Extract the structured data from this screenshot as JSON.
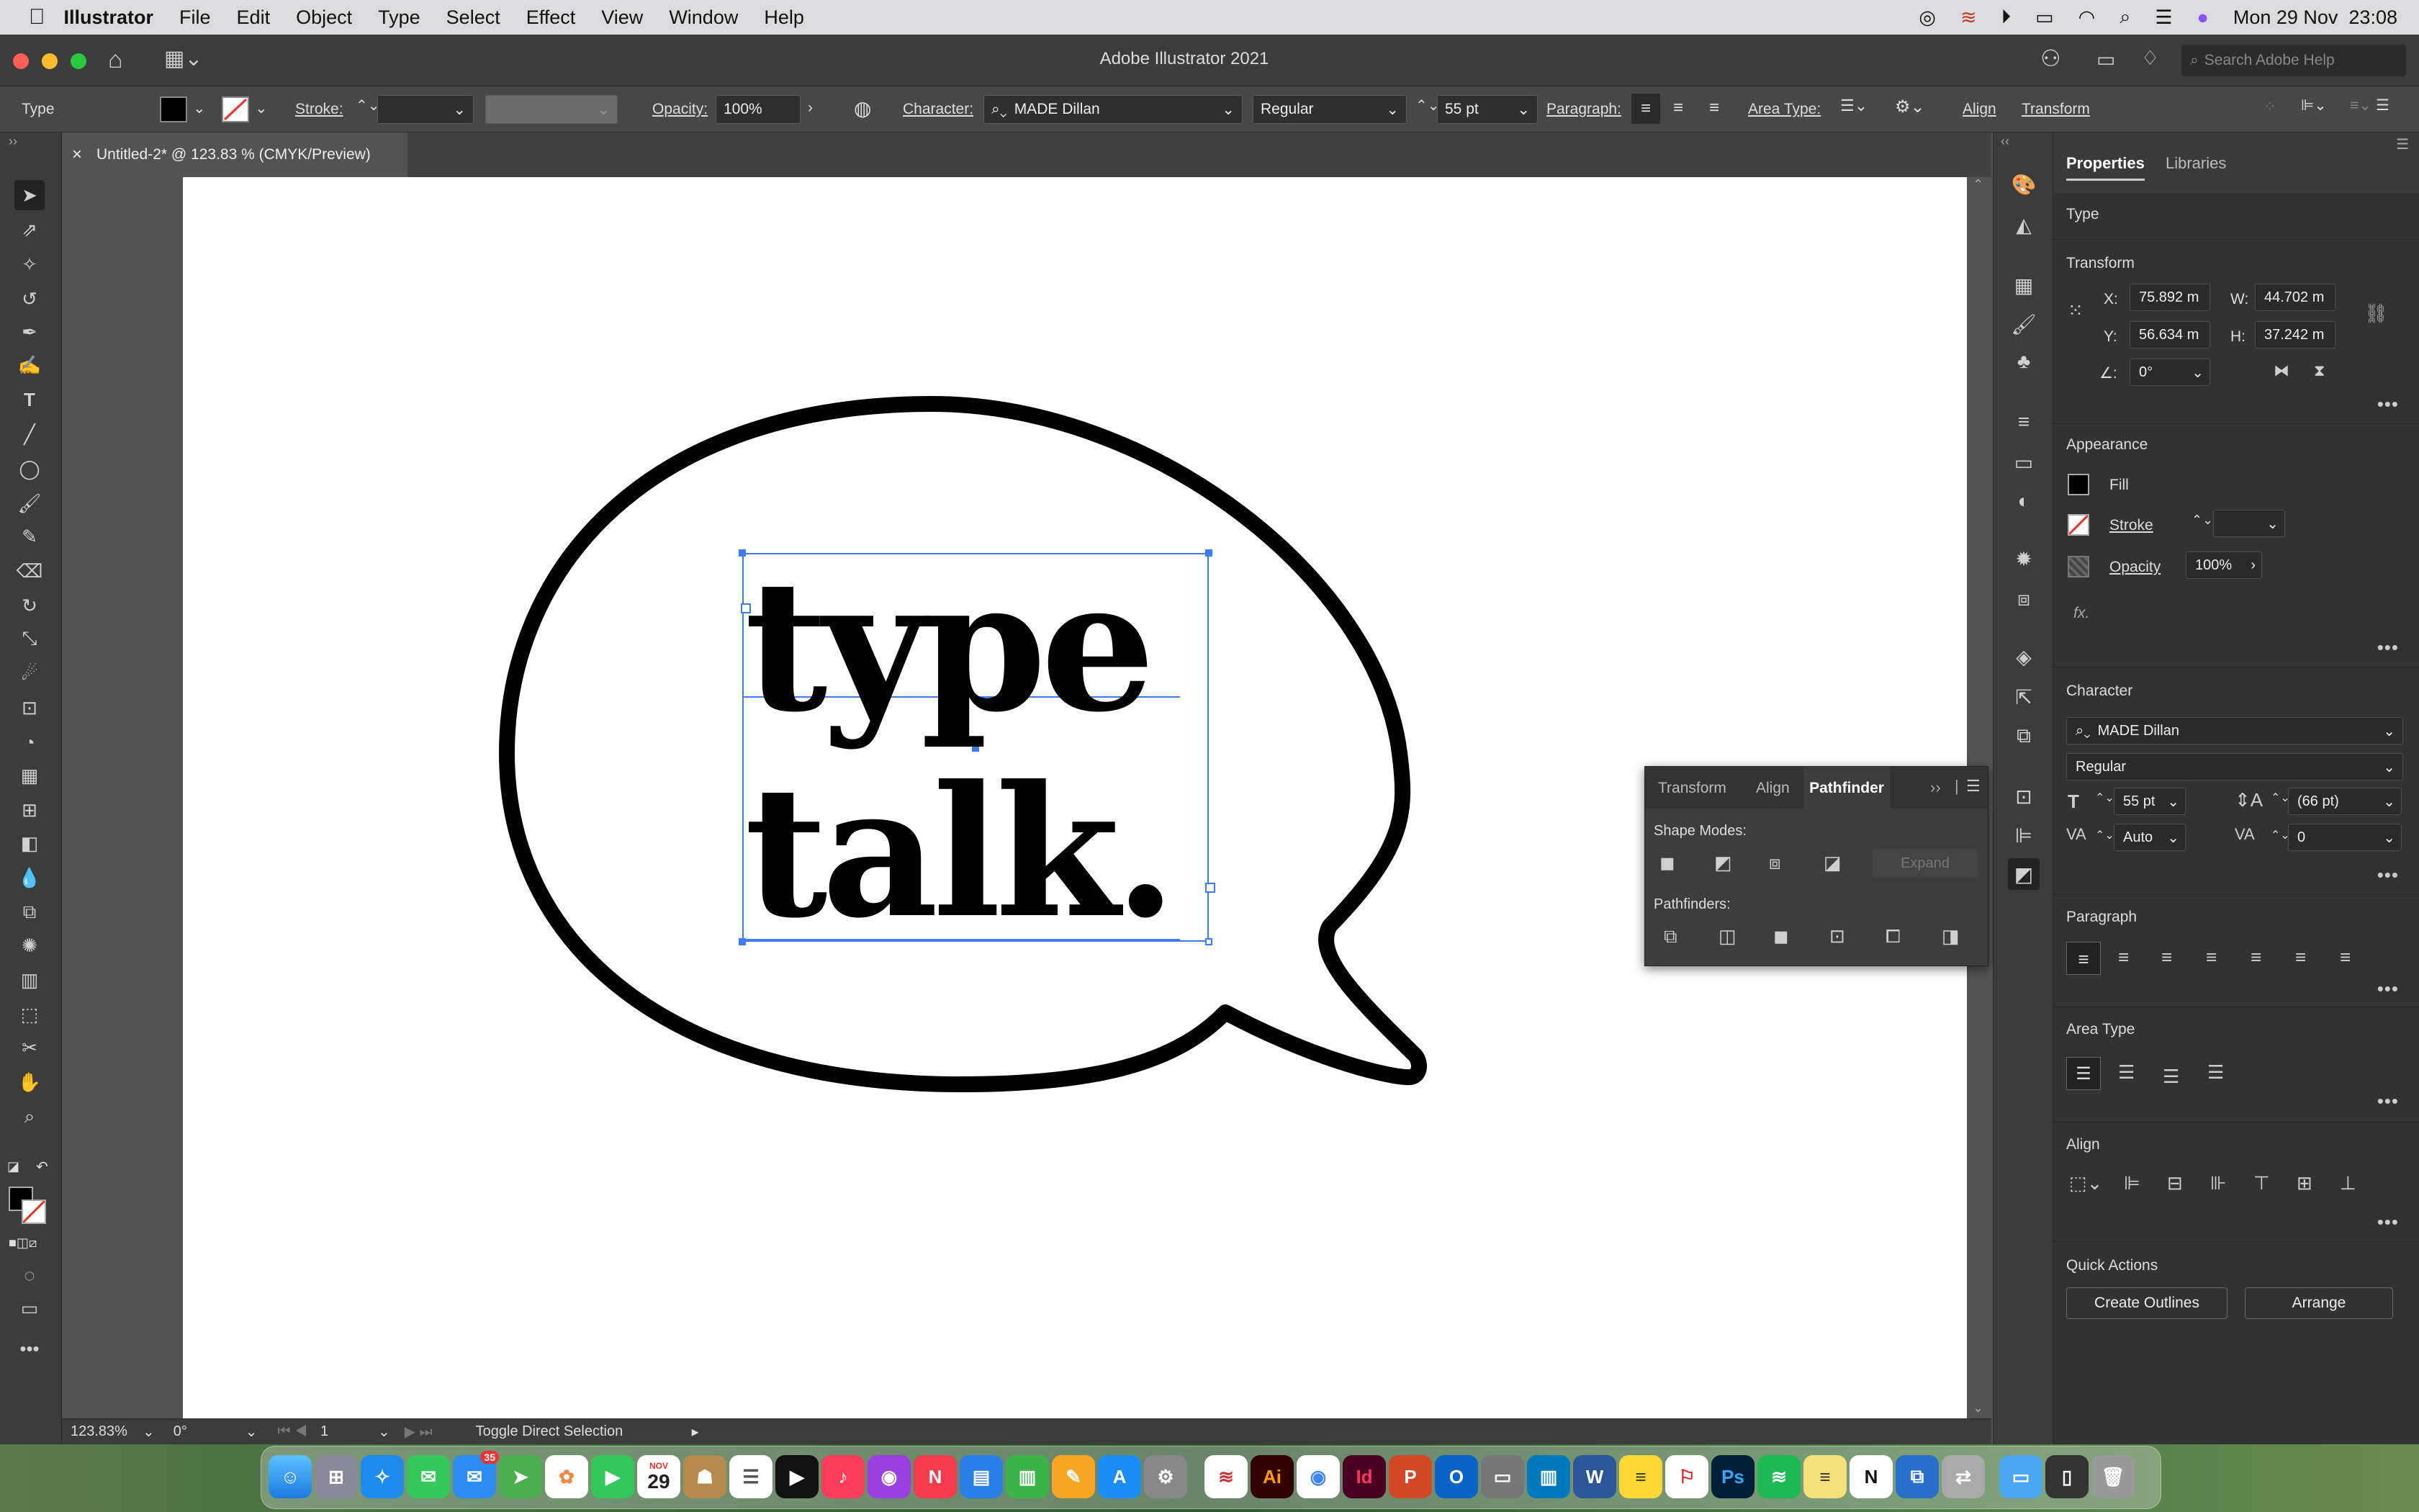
{
  "menubar": {
    "app_name": "Illustrator",
    "items": [
      "File",
      "Edit",
      "Object",
      "Type",
      "Select",
      "Effect",
      "View",
      "Window",
      "Help"
    ],
    "datetime": "Mon 29 Nov  23:08"
  },
  "titlebar": {
    "title": "Adobe Illustrator 2021",
    "search_placeholder": "Search Adobe Help"
  },
  "control_bar": {
    "selection_type": "Type",
    "stroke_label": "Stroke:",
    "opacity_label": "Opacity:",
    "opacity_value": "100%",
    "character_label": "Character:",
    "font_family": "MADE Dillan",
    "font_style": "Regular",
    "font_size": "55 pt",
    "paragraph_label": "Paragraph:",
    "area_type_label": "Area Type:",
    "align_label": "Align",
    "transform_label": "Transform"
  },
  "document_tab": {
    "title": "Untitled-2* @ 123.83 % (CMYK/Preview)",
    "close": "×"
  },
  "artwork": {
    "line1": "type",
    "line2": "talk."
  },
  "pathfinder_panel": {
    "tabs": [
      "Transform",
      "Align",
      "Pathfinder"
    ],
    "active_tab": "Pathfinder",
    "shape_modes_label": "Shape Modes:",
    "expand_label": "Expand",
    "pathfinders_label": "Pathfinders:"
  },
  "properties": {
    "tabs": [
      "Properties",
      "Libraries"
    ],
    "selection": "Type",
    "transform": {
      "title": "Transform",
      "x_label": "X:",
      "x": "75.892 m",
      "w_label": "W:",
      "w": "44.702 m",
      "y_label": "Y:",
      "y": "56.634 m",
      "h_label": "H:",
      "h": "37.242 m",
      "angle_label": "∠:",
      "angle": "0°"
    },
    "appearance": {
      "title": "Appearance",
      "fill": "Fill",
      "stroke": "Stroke",
      "opacity_label": "Opacity",
      "opacity": "100%",
      "fx": "fx."
    },
    "character": {
      "title": "Character",
      "font": "MADE Dillan",
      "style": "Regular",
      "size": "55 pt",
      "leading": "(66 pt)",
      "kerning": "Auto",
      "tracking": "0"
    },
    "paragraph": {
      "title": "Paragraph"
    },
    "area_type": {
      "title": "Area Type"
    },
    "align": {
      "title": "Align"
    },
    "quick_actions": {
      "title": "Quick Actions",
      "create_outlines": "Create Outlines",
      "arrange": "Arrange"
    }
  },
  "status_bar": {
    "zoom": "123.83%",
    "rotate": "0°",
    "artboard": "1",
    "tool_hint": "Toggle Direct Selection"
  },
  "dock": {
    "calendar_month": "NOV",
    "calendar_day": "29",
    "mail_badge": "35"
  },
  "colors": {
    "accent_selection": "#3d7bff",
    "ui_dark": "#323232",
    "artboard": "#ffffff"
  }
}
